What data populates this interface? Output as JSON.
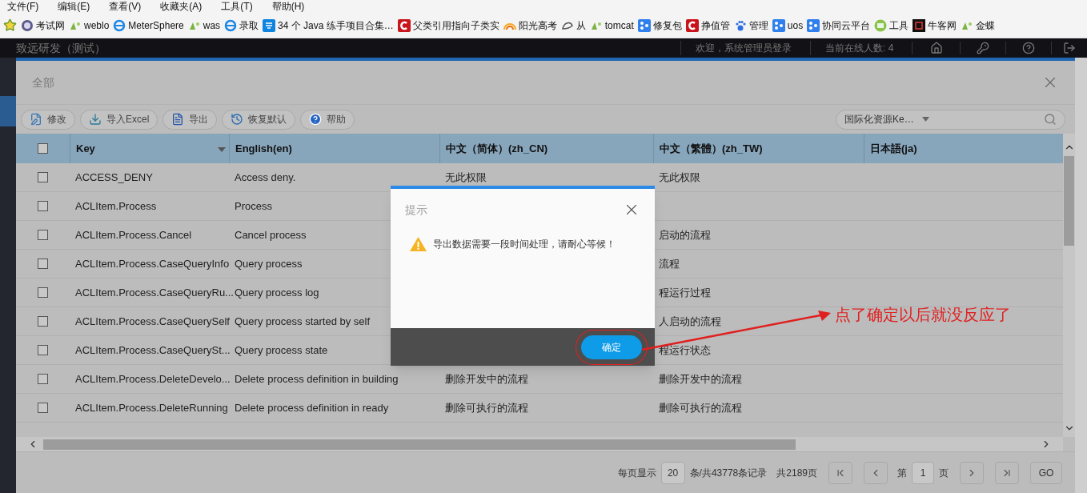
{
  "menu_bar": [
    "文件(F)",
    "编辑(E)",
    "查看(V)",
    "收藏夹(A)",
    "工具(T)",
    "帮助(H)"
  ],
  "bookmarks": [
    "考试网",
    "weblo",
    "MeterSphere",
    "was",
    "录取",
    "34 个 Java 练手项目合集…",
    "父类引用指向子类实",
    "阳光高考",
    "从",
    "tomcat",
    "修复包",
    "挣值管",
    "管理",
    "uos",
    "协同云平台",
    "工具",
    "牛客网",
    "金蝶"
  ],
  "app_header": {
    "title": "致远研发（测试）",
    "welcome": "欢迎，系统管理员登录",
    "online": "当前在线人数: 4"
  },
  "dialog": {
    "title": "全部",
    "toolbar": [
      "修改",
      "导入Excel",
      "导出",
      "恢复默认",
      "帮助"
    ],
    "search_select": {
      "value": "国际化资源Ke…"
    },
    "table": {
      "header_checked": false,
      "columns": [
        "Key",
        "English(en)",
        "中文（简体）(zh_CN)",
        "中文（繁體）(zh_TW)",
        "日本語(ja)"
      ],
      "rows": [
        {
          "checked": false,
          "cells": [
            "ACCESS_DENY",
            "Access deny.",
            "无此权限",
            "无此权限",
            ""
          ]
        },
        {
          "checked": false,
          "cells": [
            "ACLItem.Process",
            "Process",
            "",
            "",
            ""
          ]
        },
        {
          "checked": false,
          "cells": [
            "ACLItem.Process.Cancel",
            "Cancel process",
            "",
            "启动的流程",
            ""
          ]
        },
        {
          "checked": false,
          "cells": [
            "ACLItem.Process.CaseQueryInfo",
            "Query process",
            "",
            "流程",
            ""
          ]
        },
        {
          "checked": false,
          "cells": [
            "ACLItem.Process.CaseQueryRu...",
            "Query process log",
            "",
            "程运行过程",
            ""
          ]
        },
        {
          "checked": false,
          "cells": [
            "ACLItem.Process.CaseQuerySelf",
            "Query process started by self",
            "",
            "人启动的流程",
            ""
          ]
        },
        {
          "checked": false,
          "cells": [
            "ACLItem.Process.CaseQuerySt...",
            "Query process state",
            "",
            "程运行状态",
            ""
          ]
        },
        {
          "checked": false,
          "cells": [
            "ACLItem.Process.DeleteDevelo...",
            "Delete process definition in building",
            "删除开发中的流程",
            "删除开发中的流程",
            ""
          ]
        },
        {
          "checked": false,
          "cells": [
            "ACLItem.Process.DeleteRunning",
            "Delete process definition in ready",
            "删除可执行的流程",
            "删除可执行的流程",
            ""
          ]
        }
      ]
    },
    "pagination": {
      "per_page_label": "每页显示",
      "per_page": "20",
      "records": "条/共43778条记录",
      "pages": "共2189页",
      "page_prefix": "第",
      "page": "1",
      "page_suffix": "页",
      "go": "GO"
    }
  },
  "alert": {
    "title": "提示",
    "message": "导出数据需要一段时间处理，请耐心等候！",
    "button": "确定"
  },
  "annotation": {
    "text": "点了确定以后就没反应了"
  }
}
